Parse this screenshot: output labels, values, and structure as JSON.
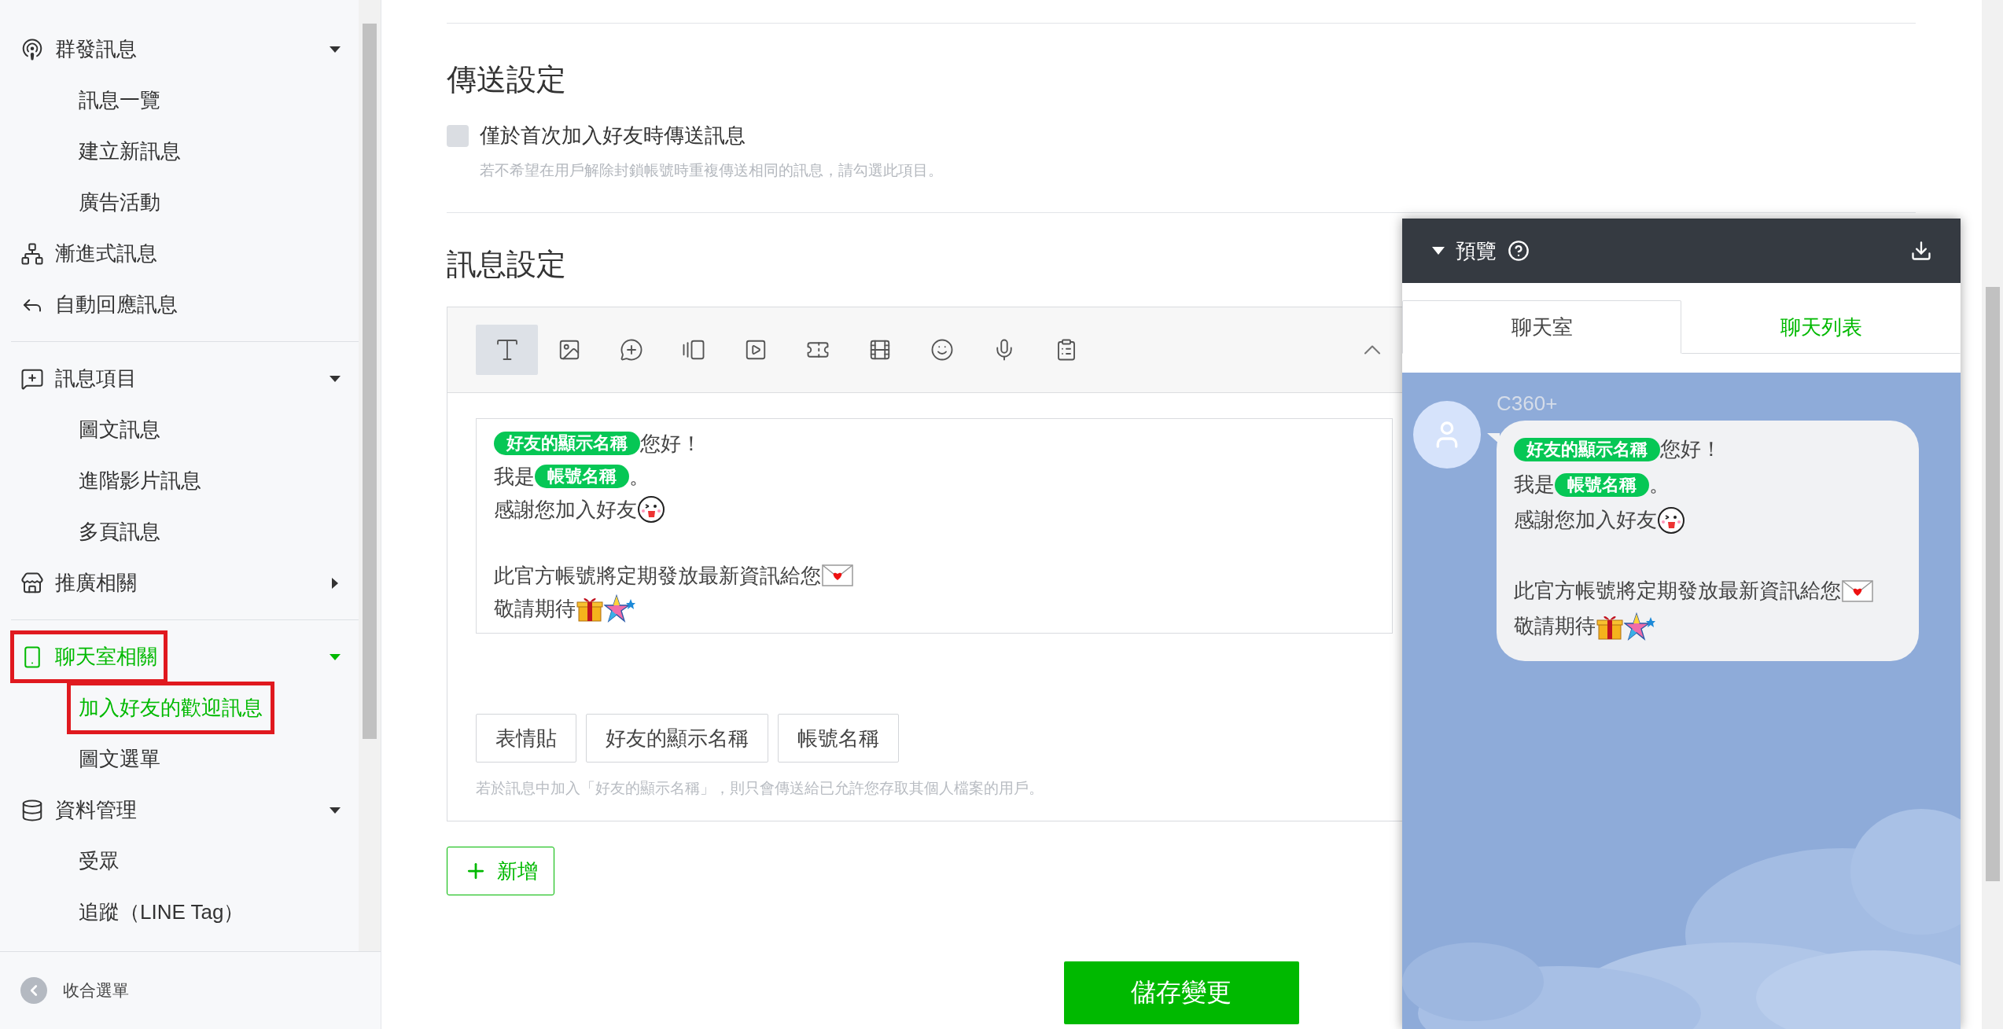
{
  "sidebar": {
    "groups": [
      {
        "items": [
          {
            "label": "群發訊息",
            "selected": false,
            "expanded": true,
            "children": [
              {
                "label": "訊息一覽",
                "selected": false
              },
              {
                "label": "建立新訊息",
                "selected": false
              },
              {
                "label": "廣告活動",
                "selected": false
              }
            ]
          },
          {
            "label": "漸進式訊息",
            "selected": false
          },
          {
            "label": "自動回應訊息",
            "selected": false
          }
        ]
      },
      {
        "items": [
          {
            "label": "訊息項目",
            "selected": false,
            "expanded": true,
            "children": [
              {
                "label": "圖文訊息",
                "selected": false
              },
              {
                "label": "進階影片訊息",
                "selected": false
              },
              {
                "label": "多頁訊息",
                "selected": false
              }
            ]
          },
          {
            "label": "推廣相關",
            "selected": false,
            "expanded": false
          }
        ]
      },
      {
        "items": [
          {
            "label": "聊天室相關",
            "selected": true,
            "annotated": true,
            "expanded": true,
            "children": [
              {
                "label": "加入好友的歡迎訊息",
                "selected": true,
                "annotated": true
              },
              {
                "label": "圖文選單",
                "selected": false
              }
            ]
          },
          {
            "label": "資料管理",
            "selected": false,
            "expanded": true,
            "children": [
              {
                "label": "受眾",
                "selected": false
              },
              {
                "label": "追蹤（LINE Tag）",
                "selected": false
              }
            ]
          }
        ]
      }
    ],
    "collapse_label": "收合選單"
  },
  "delivery": {
    "title": "傳送設定",
    "checkbox": {
      "label": "僅於首次加入好友時傳送訊息",
      "checked": false
    },
    "hint": "若不希望在用戶解除封鎖帳號時重複傳送相同的訊息，請勾選此項目。"
  },
  "message": {
    "title": "訊息設定",
    "toolbar": [
      {
        "selected": true
      },
      {
        "selected": false
      },
      {
        "selected": false
      },
      {
        "selected": false
      },
      {
        "selected": false
      },
      {
        "selected": false
      },
      {
        "selected": false
      },
      {
        "selected": false
      },
      {
        "selected": false
      },
      {
        "selected": false
      }
    ],
    "lines": [
      {
        "segments": [
          {
            "kind": "tag",
            "text": "好友的顯示名稱"
          },
          {
            "kind": "text",
            "text": "您好！"
          }
        ]
      },
      {
        "segments": [
          {
            "kind": "text",
            "text": "我是"
          },
          {
            "kind": "tag",
            "text": "帳號名稱"
          },
          {
            "kind": "text",
            "text": "。"
          }
        ]
      },
      {
        "segments": [
          {
            "kind": "text",
            "text": "感謝您加入好友"
          },
          {
            "kind": "face"
          }
        ]
      },
      {
        "kind": "blank"
      },
      {
        "segments": [
          {
            "kind": "text",
            "text": "此官方帳號將定期發放最新資訊給您"
          },
          {
            "kind": "envelope"
          }
        ]
      },
      {
        "segments": [
          {
            "kind": "text",
            "text": "敬請期待"
          },
          {
            "kind": "gift"
          },
          {
            "kind": "star"
          }
        ]
      }
    ],
    "insert_buttons": [
      "表情貼",
      "好友的顯示名稱",
      "帳號名稱"
    ],
    "hint": "若於訊息中加入「好友的顯示名稱」，則只會傳送給已允許您存取其個人檔案的用戶。",
    "add_button": "新增"
  },
  "save_button": "儲存變更",
  "preview": {
    "title": "預覽",
    "tabs": [
      {
        "label": "聊天室",
        "selected": true
      },
      {
        "label": "聊天列表",
        "selected": false
      }
    ],
    "sender": "C360+",
    "lines": [
      {
        "segments": [
          {
            "kind": "tag",
            "text": "好友的顯示名稱"
          },
          {
            "kind": "text",
            "text": "您好！"
          }
        ]
      },
      {
        "segments": [
          {
            "kind": "text",
            "text": "我是"
          },
          {
            "kind": "tag",
            "text": "帳號名稱"
          },
          {
            "kind": "text",
            "text": "。"
          }
        ]
      },
      {
        "segments": [
          {
            "kind": "text",
            "text": "感謝您加入好友"
          },
          {
            "kind": "face"
          }
        ]
      },
      {
        "kind": "blank"
      },
      {
        "segments": [
          {
            "kind": "text",
            "text": "此官方帳號將定期發放最新資訊給您"
          },
          {
            "kind": "envelope"
          }
        ]
      },
      {
        "segments": [
          {
            "kind": "text",
            "text": "敬請期待"
          },
          {
            "kind": "gift"
          },
          {
            "kind": "star"
          }
        ]
      }
    ]
  }
}
